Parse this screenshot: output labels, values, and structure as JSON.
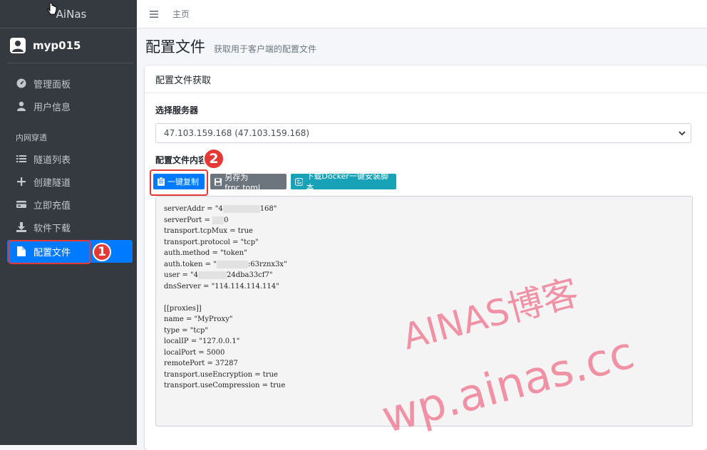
{
  "app": {
    "brand": "AiNas"
  },
  "user": {
    "name": "myp015"
  },
  "sidebar": {
    "items_top": [
      {
        "label": "管理面板",
        "icon": "gauge-icon"
      },
      {
        "label": "用户信息",
        "icon": "user-icon"
      }
    ],
    "header": "内网穿透",
    "items": [
      {
        "label": "隧道列表",
        "icon": "list-icon"
      },
      {
        "label": "创建隧道",
        "icon": "plus-icon"
      },
      {
        "label": "立即充值",
        "icon": "credit-card-icon"
      },
      {
        "label": "软件下载",
        "icon": "download-icon"
      },
      {
        "label": "配置文件",
        "icon": "file-icon",
        "active": true
      }
    ]
  },
  "topbar": {
    "breadcrumb": "主页"
  },
  "page": {
    "title": "配置文件",
    "subtitle": "获取用于客户端的配置文件"
  },
  "card": {
    "title": "配置文件获取",
    "server_label": "选择服务器",
    "server_selected": "47.103.159.168 (47.103.159.168)",
    "content_label": "配置文件内容",
    "buttons": {
      "copy": "一键复制",
      "save": "另存为 frpc.toml",
      "docker": "下载Docker一键安装脚本"
    },
    "code_lines": [
      [
        "serverAddr = \"4",
        "",
        "168\""
      ],
      [
        "serverPort = ",
        "",
        "0"
      ],
      [
        "transport.tcpMux = true"
      ],
      [
        "transport.protocol = \"tcp\""
      ],
      [
        "auth.method = \"token\""
      ],
      [
        "auth.token = \"",
        "",
        ":63rznx3x\""
      ],
      [
        "user = \"4",
        "",
        "24dba33cf7\""
      ],
      [
        "dnsServer = \"114.114.114.114\""
      ],
      [
        ""
      ],
      [
        "[[proxies]]"
      ],
      [
        "name = \"MyProxy\""
      ],
      [
        "type = \"tcp\""
      ],
      [
        "localIP = \"127.0.0.1\""
      ],
      [
        "localPort = 5000"
      ],
      [
        "remotePort = 37287"
      ],
      [
        "transport.useEncryption = true"
      ],
      [
        "transport.useCompression = true"
      ]
    ]
  },
  "annotations": {
    "step1": "1",
    "step2": "2"
  },
  "watermark": {
    "line1": "AINAS博客",
    "line2": "wp.ainas.cc"
  },
  "colors": {
    "primary": "#007bff",
    "sidebar": "#343a40",
    "highlight": "#e53935",
    "info": "#17a2b8",
    "secondary": "#6c757d"
  }
}
